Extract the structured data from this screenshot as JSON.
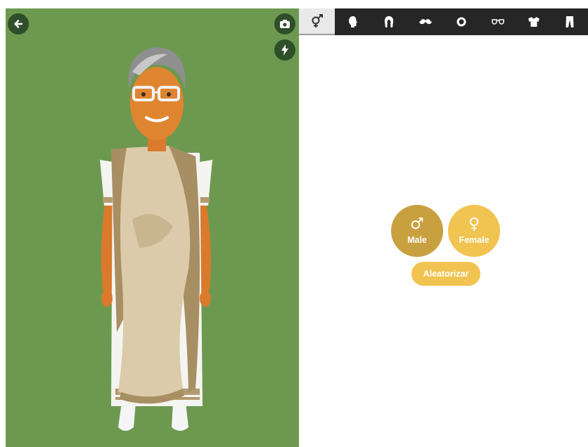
{
  "toolbar": {
    "tabs": [
      {
        "id": "gender",
        "icon": "gender-icon",
        "active": true
      },
      {
        "id": "head",
        "icon": "head-icon",
        "active": false
      },
      {
        "id": "hair",
        "icon": "hair-icon",
        "active": false
      },
      {
        "id": "facial-hair",
        "icon": "mustache-icon",
        "active": false
      },
      {
        "id": "eyes",
        "icon": "eye-icon",
        "active": false
      },
      {
        "id": "glasses",
        "icon": "glasses-icon",
        "active": false
      },
      {
        "id": "shirt",
        "icon": "shirt-icon",
        "active": false
      },
      {
        "id": "pants",
        "icon": "pants-icon",
        "active": false
      }
    ]
  },
  "preview": {
    "background_color": "#6c994f",
    "buttons": {
      "back": "back-arrow-icon",
      "camera": "camera-icon",
      "flash": "lightning-icon"
    }
  },
  "gender": {
    "male_symbol": "♂",
    "male_label": "Male",
    "female_symbol": "♀",
    "female_label": "Female",
    "selected": "male"
  },
  "randomize": {
    "label": "Aleatorizar"
  },
  "colors": {
    "male_button": "#c9a040",
    "female_button": "#f1c350",
    "toolbar": "#262626",
    "active_tab": "#e9e9e9"
  }
}
